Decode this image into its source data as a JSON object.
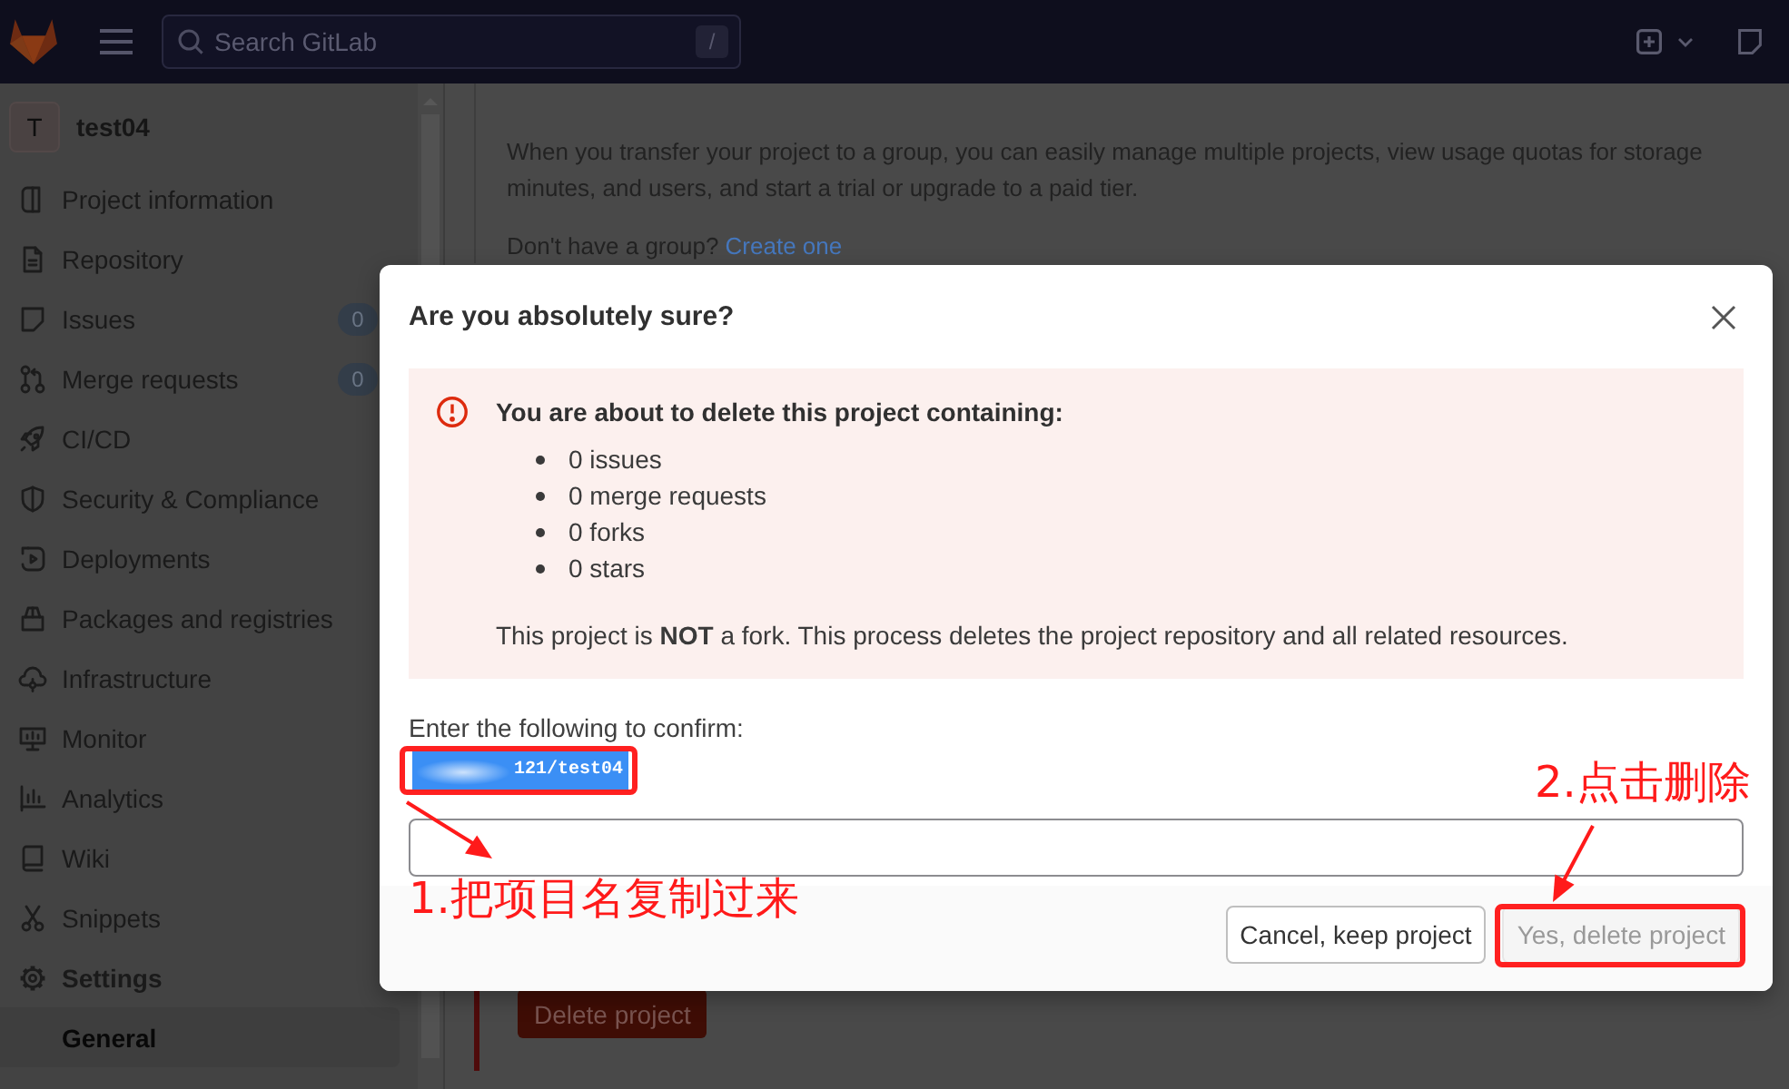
{
  "top_bar": {
    "search": {
      "placeholder": "Search GitLab",
      "shortcut": "/"
    }
  },
  "sidebar": {
    "project": {
      "avatar": "T",
      "name": "test04"
    },
    "items": [
      {
        "label": "Project information",
        "selected": false
      },
      {
        "label": "Repository",
        "selected": false
      },
      {
        "label": "Issues",
        "badge": "0",
        "selected": false
      },
      {
        "label": "Merge requests",
        "badge": "0",
        "selected": false
      },
      {
        "label": "CI/CD",
        "selected": false
      },
      {
        "label": "Security & Compliance",
        "selected": false
      },
      {
        "label": "Deployments",
        "selected": false
      },
      {
        "label": "Packages and registries",
        "selected": false
      },
      {
        "label": "Infrastructure",
        "selected": false
      },
      {
        "label": "Monitor",
        "selected": false
      },
      {
        "label": "Analytics",
        "selected": false
      },
      {
        "label": "Wiki",
        "selected": false
      },
      {
        "label": "Snippets",
        "selected": false
      },
      {
        "label": "Settings",
        "selected": true,
        "children": [
          {
            "label": "General",
            "selected": true
          }
        ]
      }
    ]
  },
  "page": {
    "transfer_text": [
      "When you transfer your project to a group, you can easily manage multiple projects, view usage quotas for storage",
      "minutes, and users, and start a trial or upgrade to a paid tier."
    ],
    "group_prompt": {
      "text": "Don't have a group?",
      "link": "Create one"
    },
    "delete_button": "Delete project"
  },
  "modal": {
    "title": "Are you absolutely sure?",
    "alert": {
      "title": "You are about to delete this project containing:",
      "items": [
        "0 issues",
        "0 merge requests",
        "0 forks",
        "0 stars"
      ],
      "note": "This project is **NOT** a fork. This process deletes the project repository and all related resources."
    },
    "confirm_label": "Enter the following to confirm:",
    "confirm_code": "121/test04",
    "buttons": [
      {
        "label": "Cancel, keep project",
        "kind": "default",
        "disabled": false
      },
      {
        "label": "Yes, delete project",
        "kind": "danger",
        "disabled": true
      }
    ]
  },
  "annotations": [
    {
      "text": "1.把项目名复制过来"
    },
    {
      "text": "2.点击删除"
    }
  ]
}
